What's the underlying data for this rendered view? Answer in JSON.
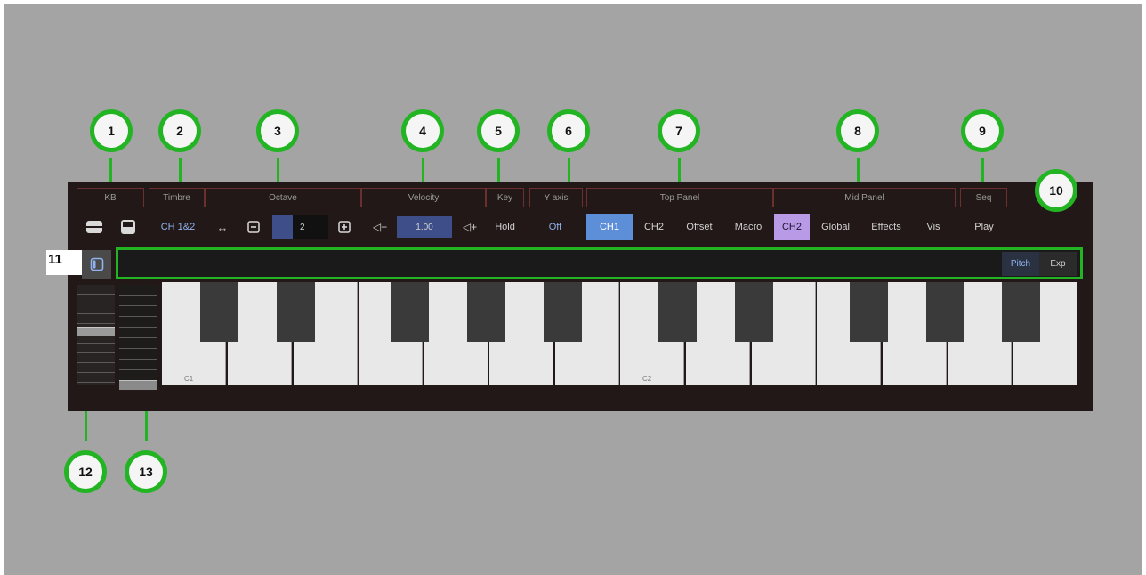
{
  "sections": {
    "kb": "KB",
    "timbre": "Timbre",
    "octave": "Octave",
    "velocity": "Velocity",
    "key": "Key",
    "yaxis": "Y axis",
    "top_panel": "Top Panel",
    "mid_panel": "Mid Panel",
    "seq": "Seq"
  },
  "controls": {
    "timbre_value": "CH 1&2",
    "octave_value": "2",
    "velocity_value": "1.00",
    "key_value": "Hold",
    "yaxis_value": "Off",
    "seq_value": "Play"
  },
  "top_panel_tabs": [
    "CH1",
    "CH2",
    "Offset",
    "Macro"
  ],
  "mid_panel_tabs": [
    "CH2",
    "Global",
    "Effects",
    "Vis"
  ],
  "strip_tabs": [
    "Pitch",
    "Exp"
  ],
  "key_labels": [
    "C1",
    "C2"
  ],
  "callouts": [
    "1",
    "2",
    "3",
    "4",
    "5",
    "6",
    "7",
    "8",
    "9",
    "10",
    "11",
    "12",
    "13"
  ],
  "icons": {
    "kb_layout_a": "rows-icon",
    "kb_layout_b": "split-icon",
    "swap": "swap-arrows-icon",
    "octave_down": "minus-box-icon",
    "octave_up": "plus-box-icon",
    "vol_down": "speaker-minus-icon",
    "vol_up": "speaker-plus-icon",
    "panel_toggle": "sidebar-toggle-icon"
  },
  "colors": {
    "callout_green": "#23b423",
    "ch1_active": "#5d8fd9",
    "ch2_active": "#b89ae6",
    "value_box": "#3d4e89"
  }
}
